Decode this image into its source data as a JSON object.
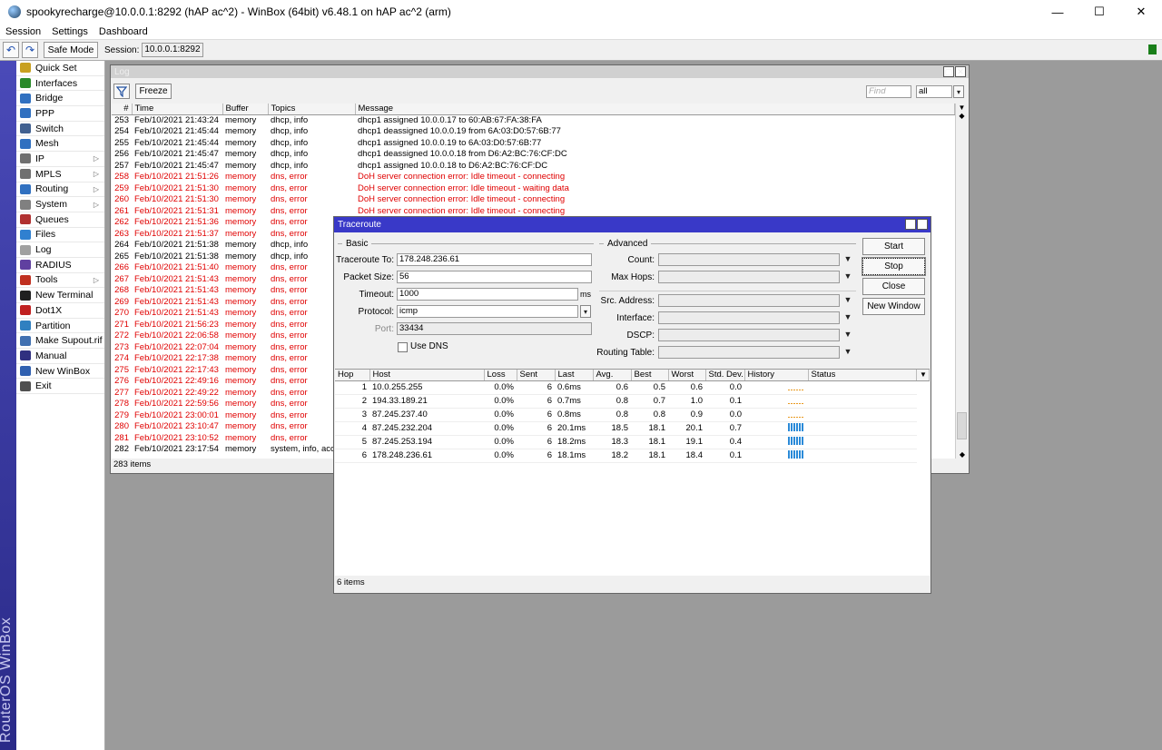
{
  "window": {
    "title": "spookyrecharge@10.0.0.1:8292 (hAP ac^2) - WinBox (64bit) v6.48.1 on hAP ac^2 (arm)",
    "controls": [
      "—",
      "☐",
      "✕"
    ]
  },
  "menu": [
    "Session",
    "Settings",
    "Dashboard"
  ],
  "toolbar": {
    "undo": "↶",
    "redo": "↷",
    "safe_mode": "Safe Mode",
    "session_label": "Session:",
    "session_value": "10.0.0.1:8292",
    "status_color": "#1a7f1a"
  },
  "brand_text": "RouterOS WinBox",
  "sidebar": [
    {
      "label": "Quick Set",
      "icon": "quickset-icon",
      "color": "#c8a020",
      "arrow": ""
    },
    {
      "label": "Interfaces",
      "icon": "interfaces-icon",
      "color": "#2a8a2a",
      "arrow": ""
    },
    {
      "label": "Bridge",
      "icon": "bridge-icon",
      "color": "#3070c0",
      "arrow": ""
    },
    {
      "label": "PPP",
      "icon": "ppp-icon",
      "color": "#3070c0",
      "arrow": ""
    },
    {
      "label": "Switch",
      "icon": "switch-icon",
      "color": "#406090",
      "arrow": ""
    },
    {
      "label": "Mesh",
      "icon": "mesh-icon",
      "color": "#3070c0",
      "arrow": ""
    },
    {
      "label": "IP",
      "icon": "ip-icon",
      "color": "#707070",
      "arrow": "▷"
    },
    {
      "label": "MPLS",
      "icon": "mpls-icon",
      "color": "#707070",
      "arrow": "▷"
    },
    {
      "label": "Routing",
      "icon": "routing-icon",
      "color": "#3070c0",
      "arrow": "▷"
    },
    {
      "label": "System",
      "icon": "system-icon",
      "color": "#808080",
      "arrow": "▷"
    },
    {
      "label": "Queues",
      "icon": "queues-icon",
      "color": "#b03030",
      "arrow": ""
    },
    {
      "label": "Files",
      "icon": "files-icon",
      "color": "#3080d0",
      "arrow": ""
    },
    {
      "label": "Log",
      "icon": "log-icon",
      "color": "#a0a0a0",
      "arrow": ""
    },
    {
      "label": "RADIUS",
      "icon": "radius-icon",
      "color": "#6040a0",
      "arrow": ""
    },
    {
      "label": "Tools",
      "icon": "tools-icon",
      "color": "#c03020",
      "arrow": "▷"
    },
    {
      "label": "New Terminal",
      "icon": "terminal-icon",
      "color": "#202020",
      "arrow": ""
    },
    {
      "label": "Dot1X",
      "icon": "dot1x-icon",
      "color": "#c02020",
      "arrow": ""
    },
    {
      "label": "Partition",
      "icon": "partition-icon",
      "color": "#3080c0",
      "arrow": ""
    },
    {
      "label": "Make Supout.rif",
      "icon": "supout-icon",
      "color": "#4070b0",
      "arrow": ""
    },
    {
      "label": "Manual",
      "icon": "manual-icon",
      "color": "#303080",
      "arrow": ""
    },
    {
      "label": "New WinBox",
      "icon": "winbox-icon",
      "color": "#3060b0",
      "arrow": ""
    },
    {
      "label": "Exit",
      "icon": "exit-icon",
      "color": "#505050",
      "arrow": ""
    }
  ],
  "log": {
    "title": "Log",
    "freeze": "Freeze",
    "find_placeholder": "Find",
    "filter_value": "all",
    "columns": [
      "#",
      "Time",
      "Buffer",
      "Topics",
      "Message"
    ],
    "rows": [
      {
        "n": "253",
        "time": "Feb/10/2021 21:43:24",
        "buffer": "memory",
        "topics": "dhcp, info",
        "msg": "dhcp1 assigned 10.0.0.17 to 60:AB:67:FA:38:FA",
        "err": false
      },
      {
        "n": "254",
        "time": "Feb/10/2021 21:45:44",
        "buffer": "memory",
        "topics": "dhcp, info",
        "msg": "dhcp1 deassigned 10.0.0.19 from 6A:03:D0:57:6B:77",
        "err": false
      },
      {
        "n": "255",
        "time": "Feb/10/2021 21:45:44",
        "buffer": "memory",
        "topics": "dhcp, info",
        "msg": "dhcp1 assigned 10.0.0.19 to 6A:03:D0:57:6B:77",
        "err": false
      },
      {
        "n": "256",
        "time": "Feb/10/2021 21:45:47",
        "buffer": "memory",
        "topics": "dhcp, info",
        "msg": "dhcp1 deassigned 10.0.0.18 from D6:A2:BC:76:CF:DC",
        "err": false
      },
      {
        "n": "257",
        "time": "Feb/10/2021 21:45:47",
        "buffer": "memory",
        "topics": "dhcp, info",
        "msg": "dhcp1 assigned 10.0.0.18 to D6:A2:BC:76:CF:DC",
        "err": false
      },
      {
        "n": "258",
        "time": "Feb/10/2021 21:51:26",
        "buffer": "memory",
        "topics": "dns, error",
        "msg": "DoH server connection error: Idle timeout - connecting",
        "err": true
      },
      {
        "n": "259",
        "time": "Feb/10/2021 21:51:30",
        "buffer": "memory",
        "topics": "dns, error",
        "msg": "DoH server connection error: Idle timeout - waiting data",
        "err": true
      },
      {
        "n": "260",
        "time": "Feb/10/2021 21:51:30",
        "buffer": "memory",
        "topics": "dns, error",
        "msg": "DoH server connection error: Idle timeout - connecting",
        "err": true
      },
      {
        "n": "261",
        "time": "Feb/10/2021 21:51:31",
        "buffer": "memory",
        "topics": "dns, error",
        "msg": "DoH server connection error: Idle timeout - connecting",
        "err": true
      },
      {
        "n": "262",
        "time": "Feb/10/2021 21:51:36",
        "buffer": "memory",
        "topics": "dns, error",
        "msg": "",
        "err": true
      },
      {
        "n": "263",
        "time": "Feb/10/2021 21:51:37",
        "buffer": "memory",
        "topics": "dns, error",
        "msg": "",
        "err": true
      },
      {
        "n": "264",
        "time": "Feb/10/2021 21:51:38",
        "buffer": "memory",
        "topics": "dhcp, info",
        "msg": "",
        "err": false
      },
      {
        "n": "265",
        "time": "Feb/10/2021 21:51:38",
        "buffer": "memory",
        "topics": "dhcp, info",
        "msg": "",
        "err": false
      },
      {
        "n": "266",
        "time": "Feb/10/2021 21:51:40",
        "buffer": "memory",
        "topics": "dns, error",
        "msg": "",
        "err": true
      },
      {
        "n": "267",
        "time": "Feb/10/2021 21:51:43",
        "buffer": "memory",
        "topics": "dns, error",
        "msg": "",
        "err": true
      },
      {
        "n": "268",
        "time": "Feb/10/2021 21:51:43",
        "buffer": "memory",
        "topics": "dns, error",
        "msg": "",
        "err": true
      },
      {
        "n": "269",
        "time": "Feb/10/2021 21:51:43",
        "buffer": "memory",
        "topics": "dns, error",
        "msg": "",
        "err": true
      },
      {
        "n": "270",
        "time": "Feb/10/2021 21:51:43",
        "buffer": "memory",
        "topics": "dns, error",
        "msg": "",
        "err": true
      },
      {
        "n": "271",
        "time": "Feb/10/2021 21:56:23",
        "buffer": "memory",
        "topics": "dns, error",
        "msg": "",
        "err": true
      },
      {
        "n": "272",
        "time": "Feb/10/2021 22:06:58",
        "buffer": "memory",
        "topics": "dns, error",
        "msg": "",
        "err": true
      },
      {
        "n": "273",
        "time": "Feb/10/2021 22:07:04",
        "buffer": "memory",
        "topics": "dns, error",
        "msg": "",
        "err": true
      },
      {
        "n": "274",
        "time": "Feb/10/2021 22:17:38",
        "buffer": "memory",
        "topics": "dns, error",
        "msg": "",
        "err": true
      },
      {
        "n": "275",
        "time": "Feb/10/2021 22:17:43",
        "buffer": "memory",
        "topics": "dns, error",
        "msg": "",
        "err": true
      },
      {
        "n": "276",
        "time": "Feb/10/2021 22:49:16",
        "buffer": "memory",
        "topics": "dns, error",
        "msg": "",
        "err": true
      },
      {
        "n": "277",
        "time": "Feb/10/2021 22:49:22",
        "buffer": "memory",
        "topics": "dns, error",
        "msg": "",
        "err": true
      },
      {
        "n": "278",
        "time": "Feb/10/2021 22:59:56",
        "buffer": "memory",
        "topics": "dns, error",
        "msg": "",
        "err": true
      },
      {
        "n": "279",
        "time": "Feb/10/2021 23:00:01",
        "buffer": "memory",
        "topics": "dns, error",
        "msg": "",
        "err": true
      },
      {
        "n": "280",
        "time": "Feb/10/2021 23:10:47",
        "buffer": "memory",
        "topics": "dns, error",
        "msg": "",
        "err": true
      },
      {
        "n": "281",
        "time": "Feb/10/2021 23:10:52",
        "buffer": "memory",
        "topics": "dns, error",
        "msg": "",
        "err": true
      },
      {
        "n": "282",
        "time": "Feb/10/2021 23:17:54",
        "buffer": "memory",
        "topics": "system, info, acco",
        "msg": "",
        "err": false
      }
    ],
    "footer": "283 items"
  },
  "traceroute": {
    "title": "Traceroute",
    "basic_label": "Basic",
    "advanced_label": "Advanced",
    "fields": {
      "to_label": "Traceroute To:",
      "to_value": "178.248.236.61",
      "size_label": "Packet Size:",
      "size_value": "56",
      "timeout_label": "Timeout:",
      "timeout_value": "1000",
      "timeout_unit": "ms",
      "protocol_label": "Protocol:",
      "protocol_value": "icmp",
      "port_label": "Port:",
      "port_value": "33434",
      "dns_label": "Use DNS"
    },
    "adv_labels": [
      "Count:",
      "Max Hops:",
      "Src. Address:",
      "Interface:",
      "DSCP:",
      "Routing Table:"
    ],
    "buttons": [
      "Start",
      "Stop",
      "Close",
      "New Window"
    ],
    "columns": [
      "Hop",
      "Host",
      "Loss",
      "Sent",
      "Last",
      "Avg.",
      "Best",
      "Worst",
      "Std. Dev.",
      "History",
      "Status"
    ],
    "rows": [
      {
        "hop": "1",
        "host": "10.0.255.255",
        "loss": "0.0%",
        "sent": "6",
        "last": "0.6ms",
        "avg": "0.6",
        "best": "0.5",
        "worst": "0.6",
        "std": "0.0",
        "hist": "low"
      },
      {
        "hop": "2",
        "host": "194.33.189.21",
        "loss": "0.0%",
        "sent": "6",
        "last": "0.7ms",
        "avg": "0.8",
        "best": "0.7",
        "worst": "1.0",
        "std": "0.1",
        "hist": "low"
      },
      {
        "hop": "3",
        "host": "87.245.237.40",
        "loss": "0.0%",
        "sent": "6",
        "last": "0.8ms",
        "avg": "0.8",
        "best": "0.8",
        "worst": "0.9",
        "std": "0.0",
        "hist": "low"
      },
      {
        "hop": "4",
        "host": "87.245.232.204",
        "loss": "0.0%",
        "sent": "6",
        "last": "20.1ms",
        "avg": "18.5",
        "best": "18.1",
        "worst": "20.1",
        "std": "0.7",
        "hist": "high"
      },
      {
        "hop": "5",
        "host": "87.245.253.194",
        "loss": "0.0%",
        "sent": "6",
        "last": "18.2ms",
        "avg": "18.3",
        "best": "18.1",
        "worst": "19.1",
        "std": "0.4",
        "hist": "high"
      },
      {
        "hop": "6",
        "host": "178.248.236.61",
        "loss": "0.0%",
        "sent": "6",
        "last": "18.1ms",
        "avg": "18.2",
        "best": "18.1",
        "worst": "18.4",
        "std": "0.1",
        "hist": "high"
      }
    ],
    "footer": "6 items"
  }
}
